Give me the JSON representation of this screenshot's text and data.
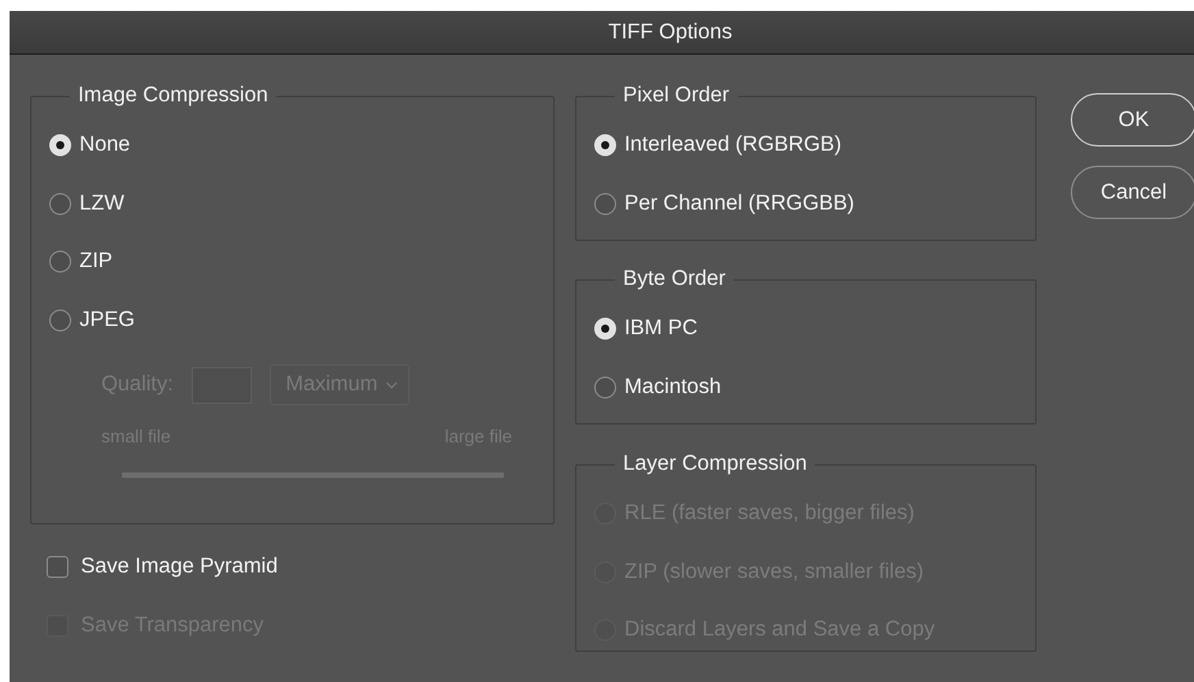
{
  "window": {
    "title": "TIFF Options"
  },
  "image_compression": {
    "title": "Image Compression",
    "options": [
      {
        "label": "None",
        "selected": true,
        "disabled": false
      },
      {
        "label": "LZW",
        "selected": false,
        "disabled": false
      },
      {
        "label": "ZIP",
        "selected": false,
        "disabled": false
      },
      {
        "label": "JPEG",
        "selected": false,
        "disabled": false
      }
    ],
    "quality": {
      "label": "Quality:",
      "select": "Maximum",
      "disabled": true,
      "min_label": "small file",
      "max_label": "large file"
    }
  },
  "checkboxes": [
    {
      "label": "Save Image Pyramid",
      "checked": false,
      "disabled": false
    },
    {
      "label": "Save Transparency",
      "checked": false,
      "disabled": true
    }
  ],
  "pixel_order": {
    "title": "Pixel Order",
    "options": [
      {
        "label": "Interleaved (RGBRGB)",
        "selected": true,
        "disabled": false
      },
      {
        "label": "Per Channel (RRGGBB)",
        "selected": false,
        "disabled": false
      }
    ]
  },
  "byte_order": {
    "title": "Byte Order",
    "options": [
      {
        "label": "IBM PC",
        "selected": true,
        "disabled": false
      },
      {
        "label": "Macintosh",
        "selected": false,
        "disabled": false
      }
    ]
  },
  "layer_compression": {
    "title": "Layer Compression",
    "options": [
      {
        "label": "RLE (faster saves, bigger files)",
        "selected": false,
        "disabled": true
      },
      {
        "label": "ZIP (slower saves, smaller files)",
        "selected": false,
        "disabled": true
      },
      {
        "label": "Discard Layers and Save a Copy",
        "selected": false,
        "disabled": true
      }
    ]
  },
  "buttons": [
    {
      "label": "OK",
      "default": true
    },
    {
      "label": "Cancel",
      "default": false
    }
  ]
}
